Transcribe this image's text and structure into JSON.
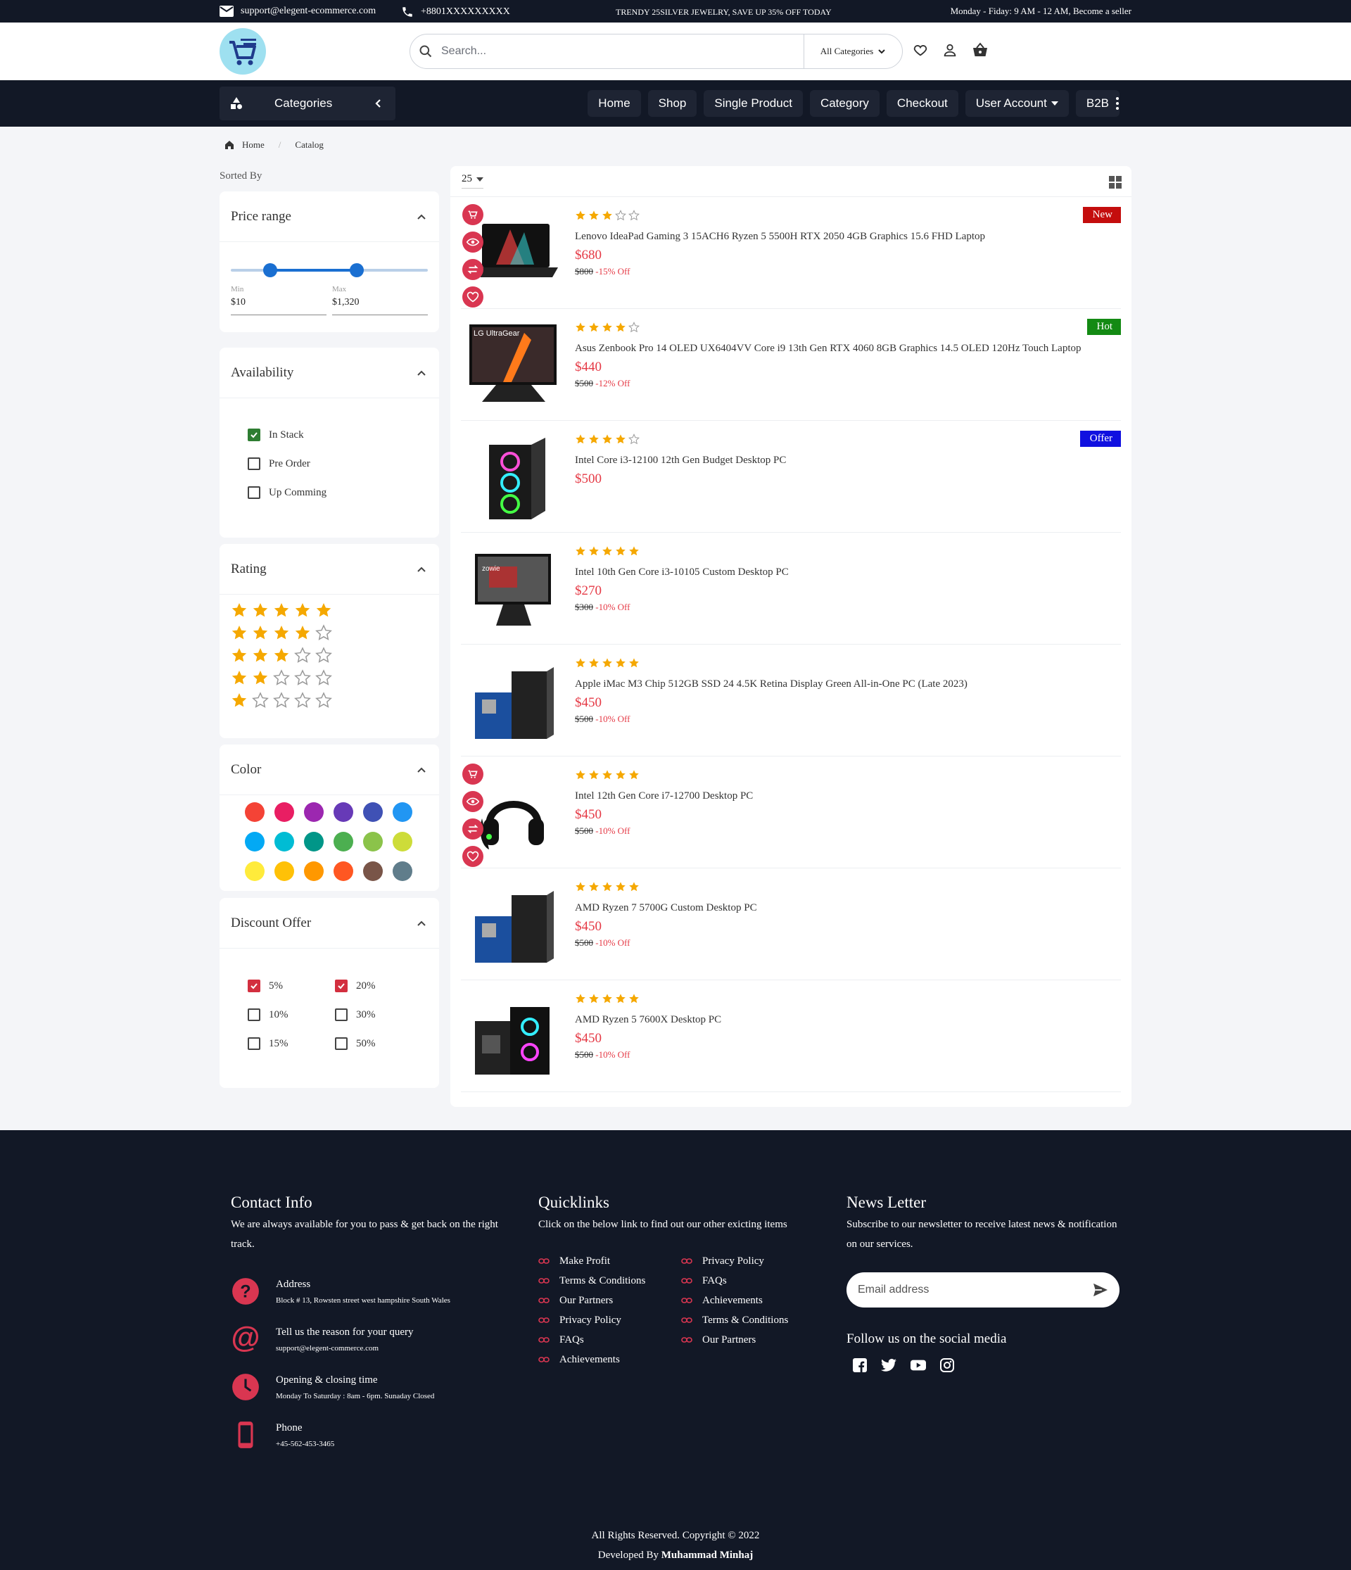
{
  "topbar": {
    "email": "support@elegent-ecommerce.com",
    "phone": "+8801XXXXXXXXX",
    "promo": "TRENDY 25SILVER JEWELRY, SAVE UP 35% OFF TODAY",
    "hours": "Monday - Fiday: 9 AM - 12 AM, Become a seller"
  },
  "header": {
    "search_placeholder": "Search...",
    "category_select": "All Categories"
  },
  "nav": {
    "categories_label": "Categories",
    "items": [
      "Home",
      "Shop",
      "Single Product",
      "Category",
      "Checkout",
      "User Account",
      "B2B"
    ]
  },
  "breadcrumb": [
    "Home",
    "Catalog"
  ],
  "sorted_by": "Sorted By",
  "filters": {
    "price": {
      "title": "Price range",
      "min_label": "Min",
      "max_label": "Max",
      "min_value": "$10",
      "max_value": "$1,320",
      "slider_low": 0.2,
      "slider_high": 0.64
    },
    "availability": {
      "title": "Availability",
      "options": [
        {
          "label": "In Stack",
          "checked": true
        },
        {
          "label": "Pre Order",
          "checked": false
        },
        {
          "label": "Up Comming",
          "checked": false
        }
      ]
    },
    "rating": {
      "title": "Rating",
      "levels": [
        5,
        4,
        3,
        2,
        1
      ]
    },
    "color": {
      "title": "Color",
      "swatches": [
        "#f44336",
        "#e91e63",
        "#9c27b0",
        "#673ab7",
        "#3f51b5",
        "#2196f3",
        "#03a9f4",
        "#00bcd4",
        "#009688",
        "#4caf50",
        "#8bc34a",
        "#cddc39",
        "#ffeb3b",
        "#ffc107",
        "#ff9800",
        "#ff5722",
        "#795548",
        "#607d8b"
      ]
    },
    "discount": {
      "title": "Discount Offer",
      "options": [
        {
          "label": "5%",
          "checked": true
        },
        {
          "label": "20%",
          "checked": true
        },
        {
          "label": "10%",
          "checked": false
        },
        {
          "label": "30%",
          "checked": false
        },
        {
          "label": "15%",
          "checked": false
        },
        {
          "label": "50%",
          "checked": false
        }
      ]
    }
  },
  "listing": {
    "per_page": "25",
    "products": [
      {
        "title": "Lenovo IdeaPad Gaming 3 15ACH6 Ryzen 5 5500H RTX 2050 4GB Graphics 15.6 FHD Laptop",
        "rating": 3,
        "price": "$680",
        "old_price": "$800",
        "discount": "-15% Off",
        "badge": "New",
        "badge_color": "#c40d0d",
        "image": "laptop",
        "actions": true
      },
      {
        "title": "Asus Zenbook Pro 14 OLED UX6404VV Core i9 13th Gen RTX 4060 8GB Graphics 14.5 OLED 120Hz Touch Laptop",
        "rating": 4,
        "price": "$440",
        "old_price": "$500",
        "discount": "-12% Off",
        "badge": "Hot",
        "badge_color": "#138a13",
        "image": "monitor",
        "actions": false
      },
      {
        "title": "Intel Core i3-12100 12th Gen Budget Desktop PC",
        "rating": 4,
        "price": "$500",
        "old_price": "",
        "discount": "",
        "badge": "Offer",
        "badge_color": "#1010e0",
        "image": "tower",
        "actions": false
      },
      {
        "title": "Intel 10th Gen Core i3-10105 Custom Desktop PC",
        "rating": 5,
        "price": "$270",
        "old_price": "$300",
        "discount": "-10% Off",
        "badge": "",
        "badge_color": "",
        "image": "gaming-monitor",
        "actions": false
      },
      {
        "title": "Apple iMac M3 Chip 512GB SSD 24 4.5K Retina Display Green All-in-One PC (Late 2023)",
        "rating": 5,
        "price": "$450",
        "old_price": "$500",
        "discount": "-10% Off",
        "badge": "",
        "badge_color": "",
        "image": "pc-board",
        "actions": false
      },
      {
        "title": "Intel 12th Gen Core i7-12700 Desktop PC",
        "rating": 5,
        "price": "$450",
        "old_price": "$500",
        "discount": "-10% Off",
        "badge": "",
        "badge_color": "",
        "image": "headset",
        "actions": true
      },
      {
        "title": "AMD Ryzen 7 5700G Custom Desktop PC",
        "rating": 5,
        "price": "$450",
        "old_price": "$500",
        "discount": "-10% Off",
        "badge": "",
        "badge_color": "",
        "image": "pc-board",
        "actions": false
      },
      {
        "title": "AMD Ryzen 5 7600X Desktop PC",
        "rating": 5,
        "price": "$450",
        "old_price": "$500",
        "discount": "-10% Off",
        "badge": "",
        "badge_color": "",
        "image": "tower-set",
        "actions": false
      }
    ]
  },
  "footer": {
    "contact": {
      "title": "Contact Info",
      "text": "We are always available for you to pass & get back on the right track.",
      "items": [
        {
          "label": "Address",
          "value": "Block # 13, Rowsten street west hampshire South Wales",
          "icon": "question-icon"
        },
        {
          "label": "Tell us the reason for your query",
          "value": "support@elegent-commerce.com",
          "icon": "at-icon"
        },
        {
          "label": "Opening & closing time",
          "value": "Monday To Saturday : 8am - 6pm. Sunaday Closed",
          "icon": "clock-icon"
        },
        {
          "label": "Phone",
          "value": "+45-562-453-3465",
          "icon": "phone-icon"
        }
      ]
    },
    "quicklinks": {
      "title": "Quicklinks",
      "text": "Click on the below link to find out our other exicting items",
      "col1": [
        "Make Profit",
        "Terms & Conditions",
        "Our Partners",
        "Privacy Policy",
        "FAQs",
        "Achievements"
      ],
      "col2": [
        "Privacy Policy",
        "FAQs",
        "Achievements",
        "Terms & Conditions",
        "Our Partners"
      ]
    },
    "newsletter": {
      "title": "News Letter",
      "text": "Subscribe to our newsletter to receive latest news & notification on our services.",
      "placeholder": "Email address",
      "social_title": "Follow us on the social media"
    },
    "copyright": "All Rights Reserved. Copyright © 2022",
    "developed_prefix": "Developed By",
    "developer": "Muhammad Minhaj"
  },
  "colors": {
    "dark": "#121826",
    "accent": "#d93651",
    "price": "#e53945",
    "star": "#f5a800"
  }
}
